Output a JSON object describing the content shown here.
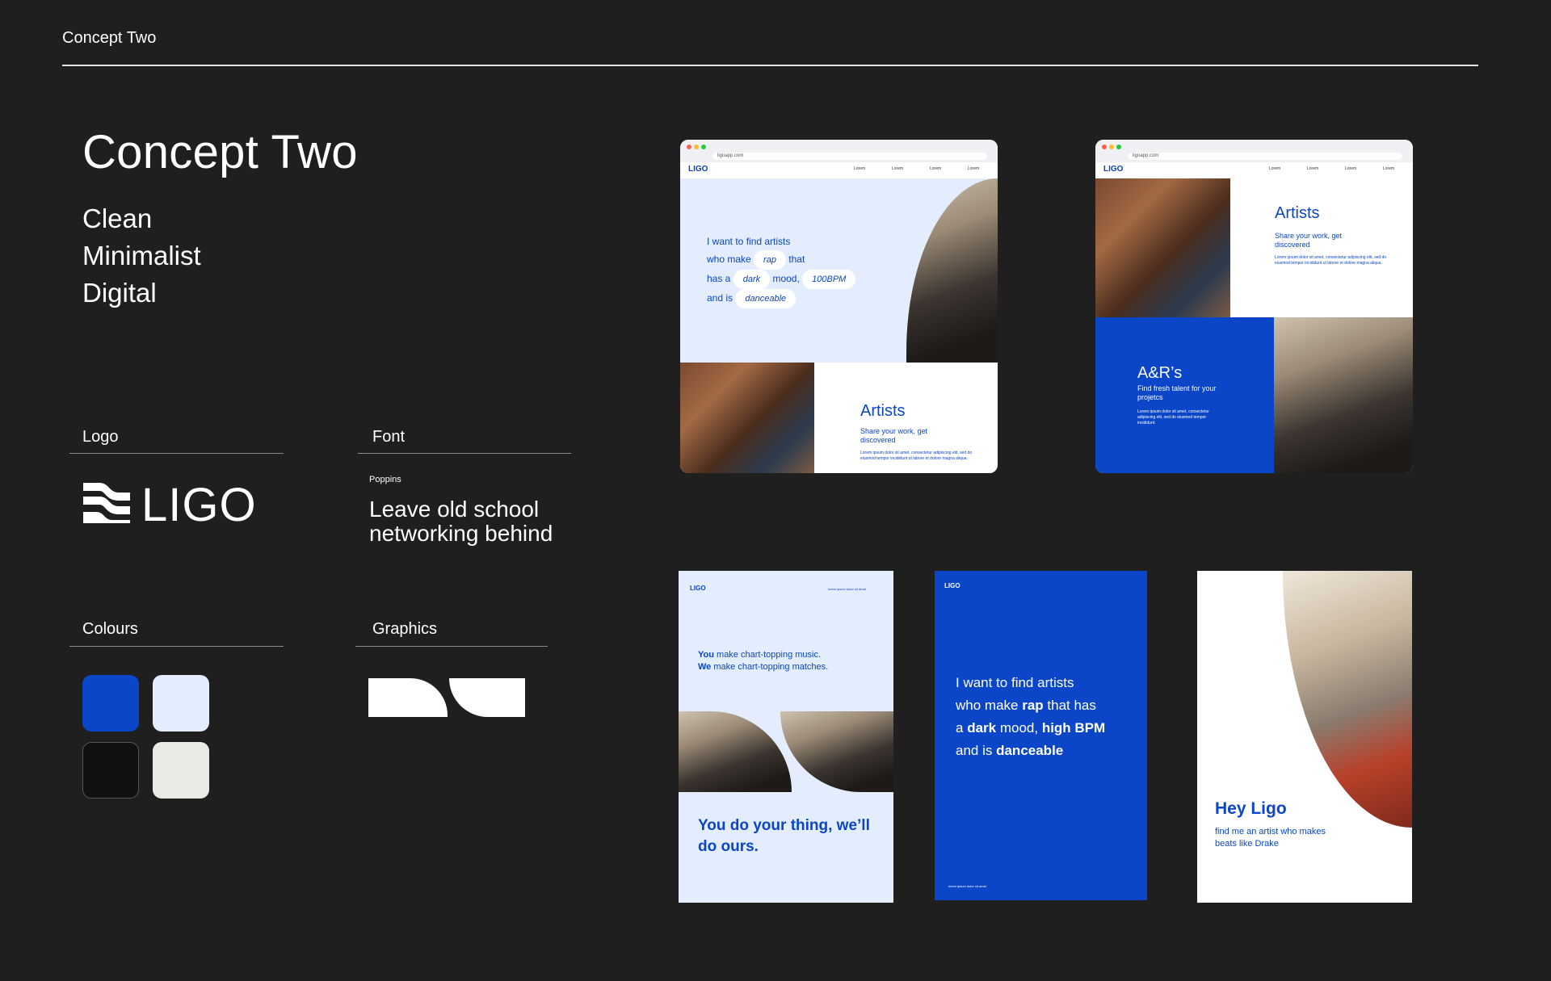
{
  "header": {
    "title": "Concept Two"
  },
  "concept": {
    "title": "Concept Two",
    "keywords": [
      "Clean",
      "Minimalist",
      "Digital"
    ]
  },
  "logo": {
    "label": "Logo",
    "wordmark": "LIGO",
    "icon": "ligo-wave-icon"
  },
  "font": {
    "label": "Font",
    "name": "Poppins",
    "sample": "Leave old school networking behind"
  },
  "colours": {
    "label": "Colours",
    "swatches": [
      "#0a46c7",
      "#e3edfd",
      "#111111",
      "#ebeae4"
    ]
  },
  "graphics": {
    "label": "Graphics"
  },
  "browser1": {
    "brand": "LIGO",
    "url": "ligoapp.com",
    "nav": [
      "Lorem",
      "Lorem",
      "Lorem",
      "Lorem"
    ],
    "line1": "I want to find artists",
    "line2_a": "who make",
    "pill_rap": "rap",
    "line2_b": "that",
    "line3_a": "has a",
    "pill_dark": "dark",
    "line3_b": "mood,",
    "pill_bpm": "100BPM",
    "line4_a": "and is",
    "pill_danceable": "danceable",
    "artists_title": "Artists",
    "artists_sub": "Share your work, get discovered",
    "artists_body": "Lorem ipsum dolor sit amet, consectetur adipiscing elit, sed do eiusmod tempor incididunt ut labore et dolore magna aliqua."
  },
  "browser2": {
    "brand": "LIGO",
    "url": "ligoapp.com",
    "nav": [
      "Lorem",
      "Lorem",
      "Lorem",
      "Lorem"
    ],
    "artists_title": "Artists",
    "artists_sub": "Share your work, get discovered",
    "artists_body": "Lorem ipsum dolor sit amet, consectetur adipiscing elit, sed do eiusmod tempor incididunt ut labore et dolore magna aliqua.",
    "ar_title": "A&R’s",
    "ar_sub": "Find fresh talent for your projetcs",
    "ar_body": "Lorem ipsum dolor sit amet, consectetur adipiscing elit, sed do eiusmod tempor incididunt."
  },
  "poster1": {
    "brand": "LIGO",
    "top_right": "lorem ipsum dolor sit amet",
    "you": "You",
    "you_rest": " make chart-topping music.",
    "we": "We",
    "we_rest": " make chart-topping matches.",
    "headline": "You do your thing, we’ll do ours."
  },
  "poster2": {
    "brand": "LIGO",
    "l1": "I want to find artists",
    "l2a": "who make ",
    "l2b": "rap",
    "l2c": " that has",
    "l3a": "a ",
    "l3b": "dark",
    "l3c": " mood, ",
    "l3d": "high BPM",
    "l4a": "and is ",
    "l4b": "danceable",
    "footer": "lorem ipsum dolor sit amet"
  },
  "poster3": {
    "title": "Hey Ligo",
    "sub": "find me an artist who makes beats like Drake"
  }
}
